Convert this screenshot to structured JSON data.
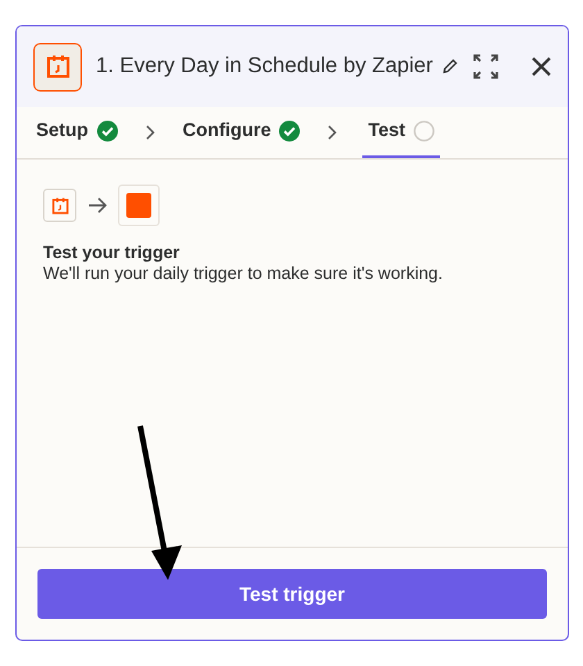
{
  "header": {
    "title": "1. Every Day in Schedule by Zapier"
  },
  "steps": [
    {
      "label": "Setup",
      "complete": true,
      "selected": false
    },
    {
      "label": "Configure",
      "complete": true,
      "selected": false
    },
    {
      "label": "Test",
      "complete": false,
      "selected": true
    }
  ],
  "test": {
    "heading": "Test your trigger",
    "description": "We'll run your daily trigger to make sure it's working."
  },
  "button": "Test trigger"
}
